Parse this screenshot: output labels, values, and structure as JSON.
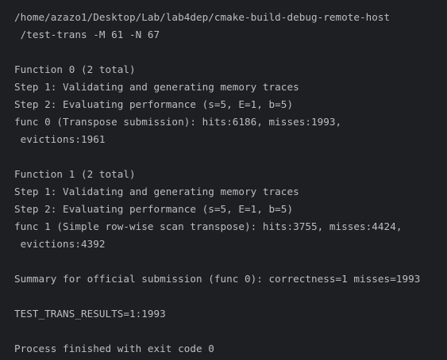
{
  "console": {
    "lines": [
      "/home/azazo1/Desktop/Lab/lab4dep/cmake-build-debug-remote-host",
      " /test-trans -M 61 -N 67",
      "",
      "Function 0 (2 total)",
      "Step 1: Validating and generating memory traces",
      "Step 2: Evaluating performance (s=5, E=1, b=5)",
      "func 0 (Transpose submission): hits:6186, misses:1993,",
      " evictions:1961",
      "",
      "Function 1 (2 total)",
      "Step 1: Validating and generating memory traces",
      "Step 2: Evaluating performance (s=5, E=1, b=5)",
      "func 1 (Simple row-wise scan transpose): hits:3755, misses:4424,",
      " evictions:4392",
      "",
      "Summary for official submission (func 0): correctness=1 misses=1993",
      "",
      "TEST_TRANS_RESULTS=1:1993",
      "",
      "Process finished with exit code 0"
    ]
  }
}
